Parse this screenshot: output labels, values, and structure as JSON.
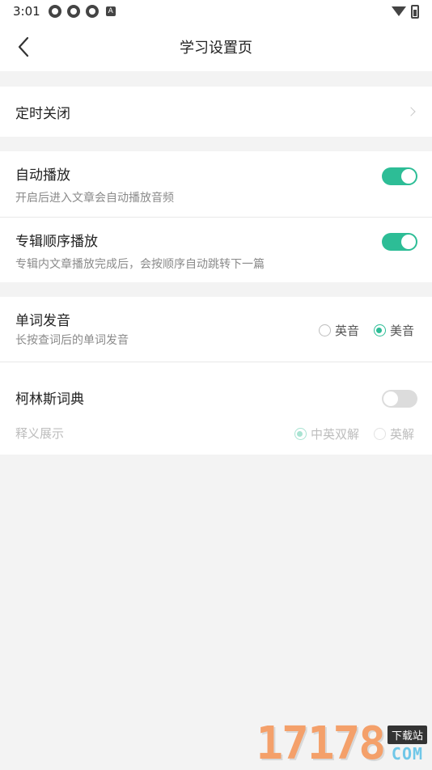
{
  "status_bar": {
    "time": "3:01",
    "notif_letter": "A"
  },
  "header": {
    "title": "学习设置页"
  },
  "timer": {
    "label": "定时关闭"
  },
  "autoplay": {
    "title": "自动播放",
    "subtitle": "开启后进入文章会自动播放音频",
    "enabled": true
  },
  "album_order": {
    "title": "专辑顺序播放",
    "subtitle": "专辑内文章播放完成后，会按顺序自动跳转下一篇",
    "enabled": true
  },
  "pronunciation": {
    "title": "单词发音",
    "subtitle": "长按查词后的单词发音",
    "options": [
      "英音",
      "美音"
    ],
    "selected": "美音"
  },
  "collins": {
    "title": "柯林斯词典",
    "enabled": false,
    "display_label": "释义展示",
    "display_options": [
      "中英双解",
      "英解"
    ],
    "display_selected": "中英双解"
  },
  "colors": {
    "accent": "#2dbd96",
    "background": "#f3f3f3"
  },
  "watermark": {
    "number": "17178",
    "tag": "下载站",
    "domain": "COM"
  }
}
